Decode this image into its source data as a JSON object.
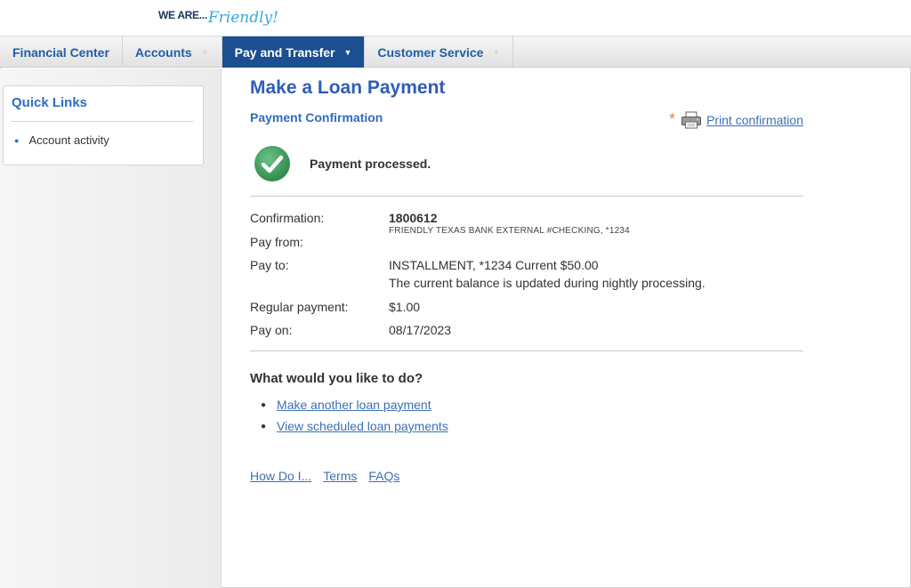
{
  "brand": {
    "logo_text_prefix": "WE ARE...",
    "logo_text_script": "Friendly!"
  },
  "nav": {
    "items": [
      {
        "label": "Financial Center",
        "has_caret": false,
        "active": false
      },
      {
        "label": "Accounts",
        "has_caret": true,
        "active": false
      },
      {
        "label": "Pay and Transfer",
        "has_caret": true,
        "active": true
      },
      {
        "label": "Customer Service",
        "has_caret": true,
        "active": false
      }
    ]
  },
  "sidebar": {
    "title": "Quick Links",
    "items": [
      {
        "label": "Account activity"
      }
    ]
  },
  "main": {
    "title": "Make a Loan Payment",
    "subtitle": "Payment Confirmation",
    "print_link": "Print confirmation",
    "status_text": "Payment processed.",
    "details": {
      "confirmation_label": "Confirmation:",
      "confirmation_value": "1800612",
      "pay_from_label": "Pay from:",
      "pay_from_value": "FRIENDLY TEXAS BANK EXTERNAL #CHECKING, *1234",
      "pay_to_label": "Pay to:",
      "pay_to_value_line1": "INSTALLMENT, *1234 Current $50.00",
      "pay_to_value_line2": "The current balance is updated during nightly processing.",
      "regular_payment_label": "Regular payment:",
      "regular_payment_value": "$1.00",
      "pay_on_label": "Pay on:",
      "pay_on_value": "08/17/2023"
    },
    "next_steps": {
      "question": "What would you like to do?",
      "links": [
        "Make another loan payment",
        "View scheduled loan payments"
      ]
    },
    "footer_links": [
      "How Do I...",
      "Terms",
      "FAQs"
    ]
  },
  "colors": {
    "nav_active_bg": "#1c4f91",
    "link": "#3b6fb8",
    "title": "#2f5db8",
    "success": "#3a9a57",
    "accent_star": "#e8833a"
  },
  "icons": {
    "success": "check-circle-icon",
    "print": "printer-icon",
    "required": "asterisk-icon",
    "dropdown": "caret-down-icon"
  }
}
